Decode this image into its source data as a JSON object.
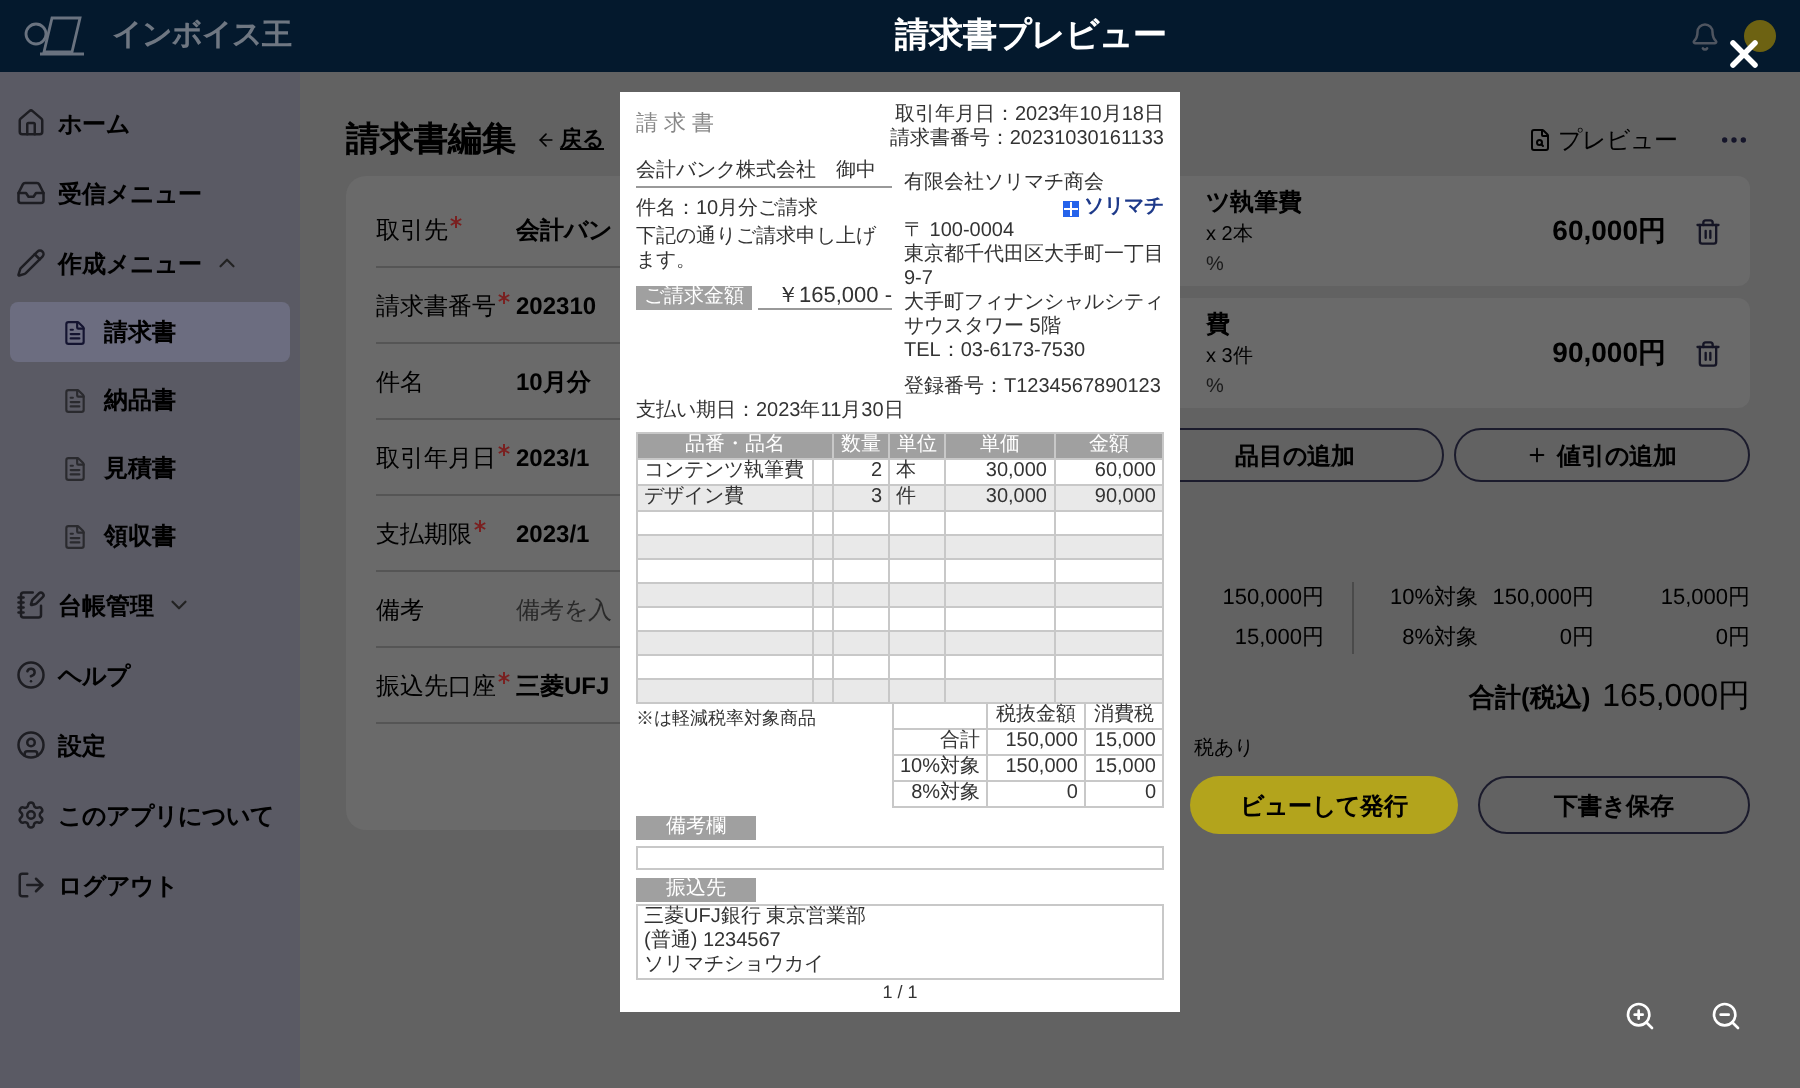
{
  "header": {
    "logo_text": "インボイス王",
    "title": "請求書プレビュー"
  },
  "sidebar": {
    "items": [
      {
        "label": "ホーム"
      },
      {
        "label": "受信メニュー"
      },
      {
        "label": "作成メニュー",
        "expanded": true,
        "children": [
          {
            "label": "請求書",
            "selected": true
          },
          {
            "label": "納品書",
            "selected": false
          },
          {
            "label": "見積書",
            "selected": false
          },
          {
            "label": "領収書",
            "selected": false
          }
        ]
      },
      {
        "label": "台帳管理",
        "expanded": false
      },
      {
        "label": "ヘルプ"
      },
      {
        "label": "設定"
      },
      {
        "label": "このアプリについて"
      },
      {
        "label": "ログアウト"
      }
    ]
  },
  "page": {
    "title": "請求書編集",
    "back_label": "戻る",
    "preview_label": "プレビュー"
  },
  "form": {
    "rows": [
      {
        "label": "取引先",
        "required": true,
        "value": "会計バン"
      },
      {
        "label": "請求書番号",
        "required": true,
        "value": "202310"
      },
      {
        "label": "件名",
        "required": false,
        "value": "10月分"
      },
      {
        "label": "取引年月日",
        "required": true,
        "value": "2023/1"
      },
      {
        "label": "支払期限",
        "required": true,
        "value": "2023/1"
      },
      {
        "label": "備考",
        "required": false,
        "placeholder": "備考を入"
      },
      {
        "label": "振込先口座",
        "required": true,
        "value": "三菱UFJ"
      }
    ]
  },
  "items": [
    {
      "name": "ツ執筆費",
      "quantity": "x 2本",
      "tax": "%",
      "amount": "60,000円"
    },
    {
      "name": "費",
      "quantity": "x 3件",
      "tax": "%",
      "amount": "90,000円"
    }
  ],
  "add_buttons": [
    {
      "label": "品目の追加",
      "plus": false
    },
    {
      "label": "値引の追加",
      "plus": true
    }
  ],
  "summary": {
    "subtotal": "150,000円",
    "tax": "15,000円",
    "rates": [
      {
        "label": "10%対象",
        "base": "150,000円",
        "tax": "15,000円"
      },
      {
        "label": "8%対象",
        "base": "0円",
        "tax": "0円"
      }
    ],
    "total_label": "合計(税込)",
    "total": "165,000円",
    "note": "税あり"
  },
  "actions": [
    {
      "label": "ビューして発行",
      "kind": "primary"
    },
    {
      "label": "下書き保存",
      "kind": "secondary"
    }
  ],
  "document": {
    "title": "請 求 書",
    "date": "取引年月日：2023年10月18日",
    "number": "請求書番号：20231030161133",
    "client": "会計バンク株式会社　御中",
    "subject": "件名：10月分ご請求",
    "message": "下記の通りご請求申し上げます。",
    "amount_label": "ご請求金額",
    "amount": "￥165,000 -",
    "due": "支払い期日：2023年11月30日",
    "issuer": {
      "name": "有限会社ソリマチ商会",
      "logo_text": "ソリマチ",
      "postal": "〒 100-0004",
      "address": "東京都千代田区大手町一丁目9-7",
      "building": "大手町フィナンシャルシティサウスタワー 5階",
      "tel": "TEL：03-6173-7530",
      "registration": "登録番号：T1234567890123"
    },
    "table": {
      "columns": [
        "品番・品名",
        "数量",
        "単位",
        "単価",
        "金額"
      ],
      "rows": [
        {
          "name": "コンテンツ執筆費",
          "quantity": "2",
          "unit": "本",
          "price": "30,000",
          "amount": "60,000"
        },
        {
          "name": "デザイン費",
          "quantity": "3",
          "unit": "件",
          "price": "30,000",
          "amount": "90,000"
        },
        {},
        {},
        {},
        {},
        {},
        {},
        {},
        {}
      ]
    },
    "reduced_note": "※は軽減税率対象商品",
    "tax_table": {
      "columns": [
        "税抜金額",
        "消費税"
      ],
      "rows": [
        {
          "label": "合計",
          "base": "150,000",
          "tax": "15,000"
        },
        {
          "label": "10%対象",
          "base": "150,000",
          "tax": "15,000"
        },
        {
          "label": "8%対象",
          "base": "0",
          "tax": "0"
        }
      ]
    },
    "remarks_label": "備考欄",
    "bank_label": "振込先",
    "bank_lines": [
      "三菱UFJ銀行 東京営業部",
      "(普通) 1234567",
      "ソリマチショウカイ"
    ],
    "page_number": "1 / 1"
  }
}
